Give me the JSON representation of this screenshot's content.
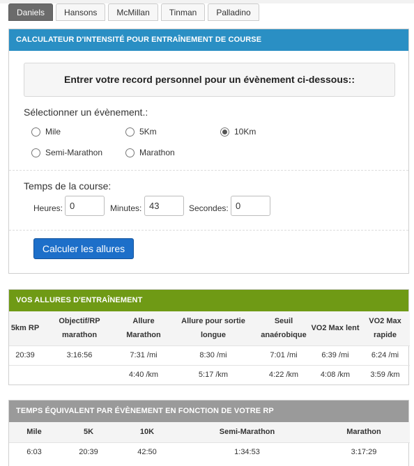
{
  "tabs": [
    "Daniels",
    "Hansons",
    "McMillan",
    "Tinman",
    "Palladino"
  ],
  "active_tab": "Daniels",
  "calculator": {
    "title": "CALCULATEUR D'INTENSITÉ POUR ENTRAÎNEMENT DE COURSE",
    "prompt": "Entrer votre record personnel pour un évènement ci-dessous::",
    "select_label": "Sélectionner un évènement.:",
    "events": [
      "Mile",
      "5Km",
      "10Km",
      "Semi-Marathon",
      "Marathon"
    ],
    "selected_event": "10Km",
    "time_label": "Temps de la course:",
    "hours_label": "Heures:",
    "hours_value": "0",
    "minutes_label": "Minutes:",
    "minutes_value": "43",
    "seconds_label": "Secondes:",
    "seconds_value": "0",
    "button": "Calculer les allures"
  },
  "training": {
    "title": "VOS ALLURES D'ENTRAÎNEMENT",
    "headers": [
      "5km RP",
      "Objectif/RP marathon",
      "Allure Marathon",
      "Allure pour sortie longue",
      "Seuil anaérobique",
      "VO2 Max lent",
      "VO2 Max rapide"
    ],
    "rows": [
      [
        "20:39",
        "3:16:56",
        "7:31 /mi",
        "8:30 /mi",
        "7:01 /mi",
        "6:39 /mi",
        "6:24 /mi"
      ],
      [
        "",
        "",
        "4:40 /km",
        "5:17 /km",
        "4:22 /km",
        "4:08 /km",
        "3:59 /km"
      ]
    ]
  },
  "equivalent": {
    "title": "TEMPS ÉQUIVALENT PAR ÉVÈNEMENT EN FONCTION DE VOTRE RP",
    "headers": [
      "Mile",
      "5K",
      "10K",
      "Semi-Marathon",
      "Marathon"
    ],
    "rows": [
      [
        "6:03",
        "20:39",
        "42:50",
        "1:34:53",
        "3:17:29"
      ]
    ]
  }
}
